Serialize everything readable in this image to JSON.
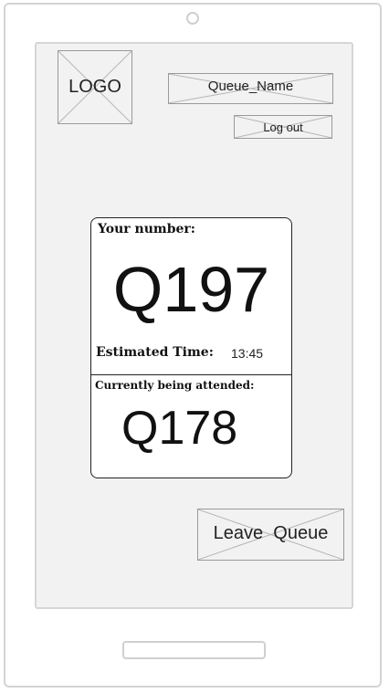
{
  "header": {
    "logo_label": "LOGO",
    "queue_name": "Queue_Name",
    "logout_label": "Log out"
  },
  "ticket": {
    "your_number_label": "Your number:",
    "your_number": "Q197",
    "estimated_time_label": "Estimated Time:",
    "estimated_time": "13:45",
    "currently_attended_label": "Currently being attended:",
    "currently_attended_number": "Q178"
  },
  "actions": {
    "leave_queue_label": "Leave  Queue"
  },
  "colors": {
    "screen_background": "#f2f2f2",
    "placeholder_border": "#9a9a9a",
    "card_background": "#ffffff",
    "text": "#111111"
  }
}
